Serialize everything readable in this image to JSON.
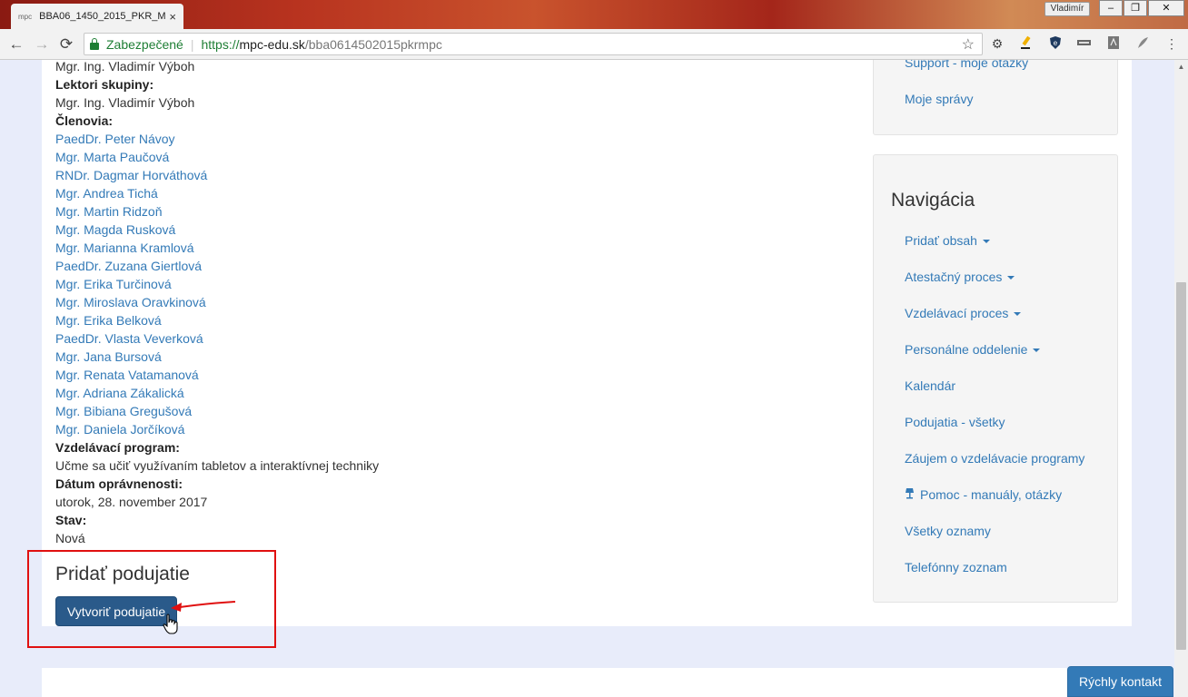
{
  "browser": {
    "tab_title": "BBA06_1450_2015_PKR_M",
    "tab_favicon": "mpc",
    "tab_close": "×",
    "profile_name": "Vladimír",
    "window_buttons": {
      "minimize": "–",
      "maximize": "❐",
      "close": "✕"
    },
    "nav": {
      "back": "←",
      "forward": "→",
      "reload": "⟳"
    },
    "address": {
      "secure_label": "Zabezpečené",
      "url_proto": "https://",
      "url_host": "mpc-edu.sk",
      "url_path": "/bba0614502015pkrmpc"
    },
    "bookmark_star": "☆",
    "extension_icons": [
      "gear-icon",
      "highlighter-icon",
      "shield-icon",
      "battery-icon",
      "pdf-icon",
      "feather-icon",
      "menu-icon"
    ]
  },
  "group": {
    "top_name": "Mgr. Ing. Vladimír Výboh",
    "lecturers_label": "Lektori skupiny:",
    "lecturer": "Mgr. Ing. Vladimír Výboh",
    "members_label": "Členovia:",
    "members": [
      "PaedDr. Peter Návoy",
      "Mgr. Marta Paučová",
      "RNDr. Dagmar Horváthová",
      "Mgr. Andrea Tichá",
      "Mgr. Martin Ridzoň",
      "Mgr. Magda Rusková",
      "Mgr. Marianna Kramlová",
      "PaedDr. Zuzana Giertlová",
      "Mgr. Erika Turčinová",
      "Mgr. Miroslava Oravkinová",
      "Mgr. Erika Belková",
      "PaedDr. Vlasta Veverková",
      "Mgr. Jana Bursová",
      "Mgr. Renata Vatamanová",
      "Mgr. Adriana Zákalická",
      "Mgr. Bibiana Gregušová",
      "Mgr. Daniela Jorčíková"
    ],
    "program_label": "Vzdelávací program:",
    "program": "Učme sa učiť využívaním tabletov a interaktívnej techniky",
    "date_label": "Dátum oprávnenosti:",
    "date": "utorok, 28. november 2017",
    "status_label": "Stav:",
    "status": "Nová"
  },
  "event": {
    "title": "Pridať podujatie",
    "create_button": "Vytvoriť podujatie"
  },
  "sidebar": {
    "top_links": [
      "Support - moje otázky",
      "Moje správy"
    ],
    "nav_title": "Navigácia",
    "nav_items": [
      {
        "label": "Pridať obsah",
        "dropdown": true
      },
      {
        "label": "Atestačný proces",
        "dropdown": true
      },
      {
        "label": "Vzdelávací proces",
        "dropdown": true
      },
      {
        "label": "Personálne oddelenie",
        "dropdown": true
      },
      {
        "label": "Kalendár",
        "dropdown": false
      },
      {
        "label": "Podujatia - všetky",
        "dropdown": false
      },
      {
        "label": "Záujem o vzdelávacie programy",
        "dropdown": false
      },
      {
        "label": "Pomoc - manuály, otázky",
        "dropdown": false,
        "icon": "lamp-icon"
      },
      {
        "label": "Všetky oznamy",
        "dropdown": false
      },
      {
        "label": "Telefónny zoznam",
        "dropdown": false
      }
    ]
  },
  "quick_contact": "Rýchly kontakt",
  "colors": {
    "link": "#337ab7",
    "primary_button": "#2a5a8a",
    "highlight": "#e01010",
    "page_background": "#e8ecfa"
  }
}
